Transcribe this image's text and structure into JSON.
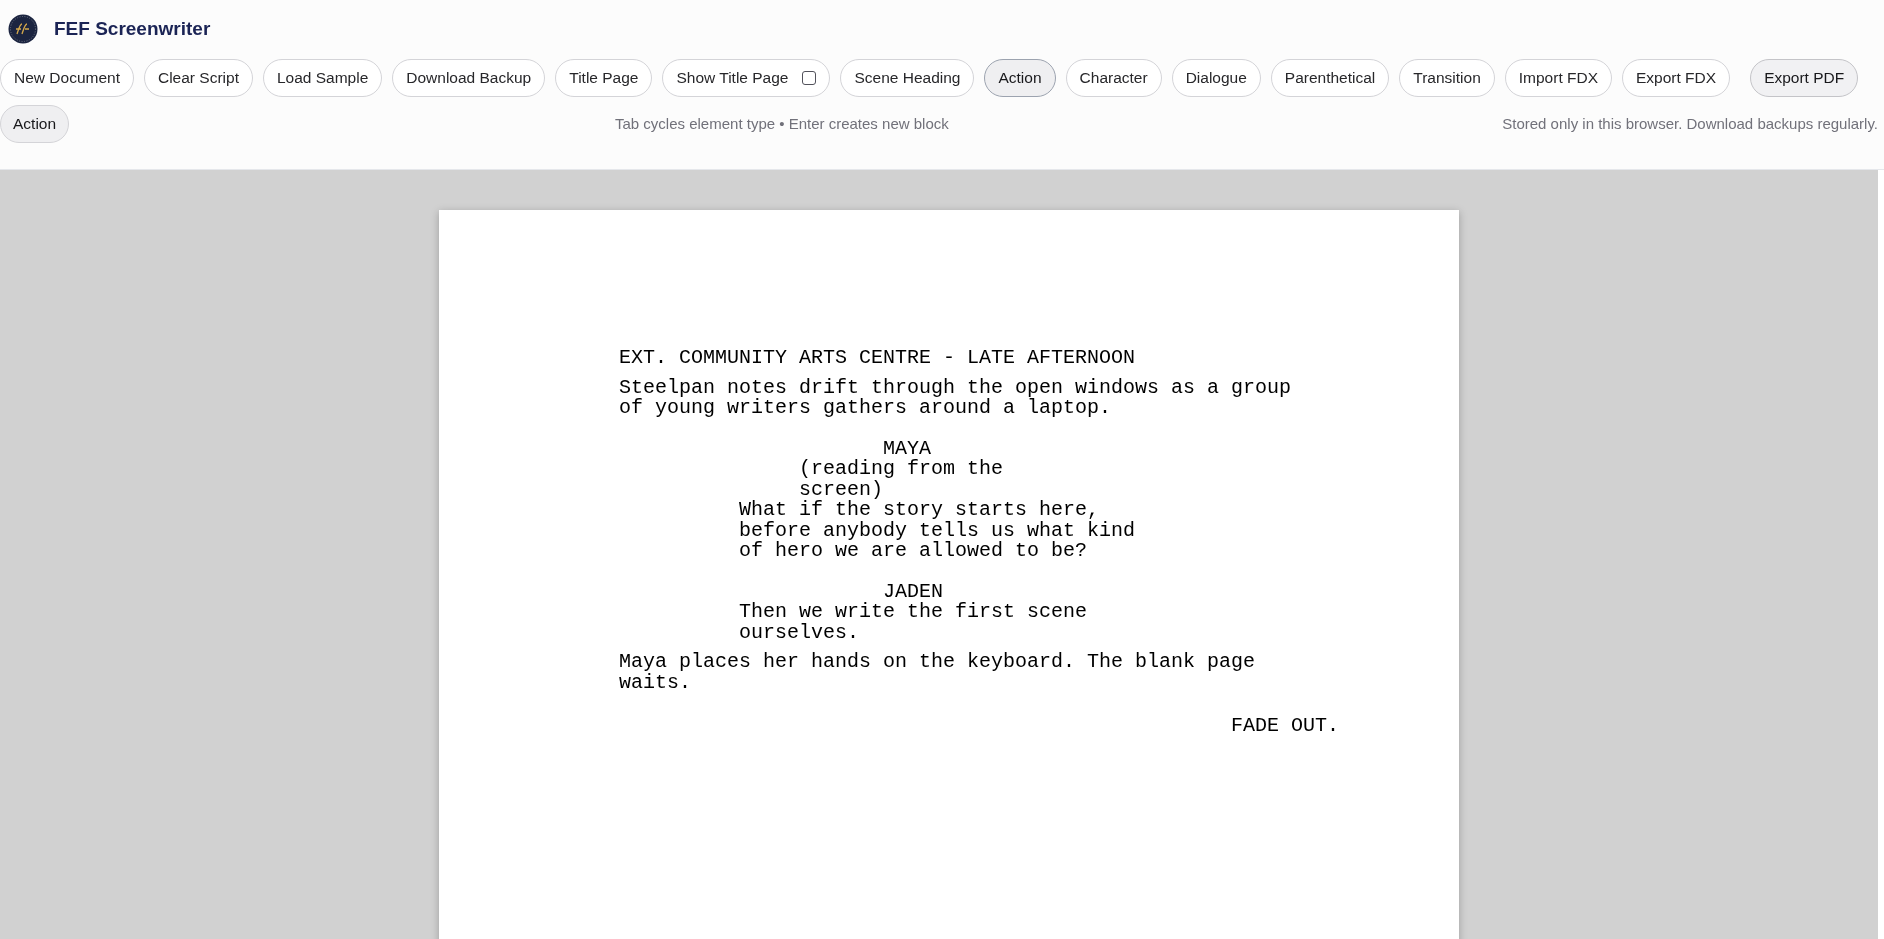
{
  "app": {
    "title": "FEF Screenwriter"
  },
  "toolbar": [
    {
      "kind": "button",
      "label": "New Document"
    },
    {
      "kind": "button",
      "label": "Clear Script"
    },
    {
      "kind": "button",
      "label": "Load Sample"
    },
    {
      "kind": "button",
      "label": "Download Backup"
    },
    {
      "kind": "button",
      "label": "Title Page"
    },
    {
      "kind": "checkbox",
      "label": "Show Title Page",
      "checked": false
    },
    {
      "kind": "element",
      "label": "Scene Heading",
      "selected": false
    },
    {
      "kind": "element",
      "label": "Action",
      "selected": true
    },
    {
      "kind": "element",
      "label": "Character",
      "selected": false
    },
    {
      "kind": "element",
      "label": "Dialogue",
      "selected": false
    },
    {
      "kind": "element",
      "label": "Parenthetical",
      "selected": false
    },
    {
      "kind": "element",
      "label": "Transition",
      "selected": false
    },
    {
      "kind": "button",
      "label": "Import FDX"
    },
    {
      "kind": "button",
      "label": "Export FDX"
    },
    {
      "kind": "export",
      "label": "Export PDF"
    }
  ],
  "status_row": {
    "current_element": "Action",
    "hint": "Tab cycles element type • Enter creates new block",
    "notice": "Stored only in this browser. Download backups regularly."
  },
  "script": [
    {
      "kind": "scene_heading",
      "text": "EXT. COMMUNITY ARTS CENTRE - LATE AFTERNOON"
    },
    {
      "kind": "action",
      "text": "Steelpan notes drift through the open windows as a group of young writers gathers around a laptop."
    },
    {
      "kind": "character",
      "text": "MAYA"
    },
    {
      "kind": "parenthetical",
      "text": "(reading from the screen)"
    },
    {
      "kind": "dialogue",
      "text": "What if the story starts here, before anybody tells us what kind of hero we are allowed to be?"
    },
    {
      "kind": "character",
      "text": "JADEN"
    },
    {
      "kind": "dialogue",
      "text": "Then we write the first scene ourselves."
    },
    {
      "kind": "action",
      "text": "Maya places her hands on the keyboard. The blank page waits."
    },
    {
      "kind": "transition",
      "text": "FADE OUT."
    }
  ]
}
